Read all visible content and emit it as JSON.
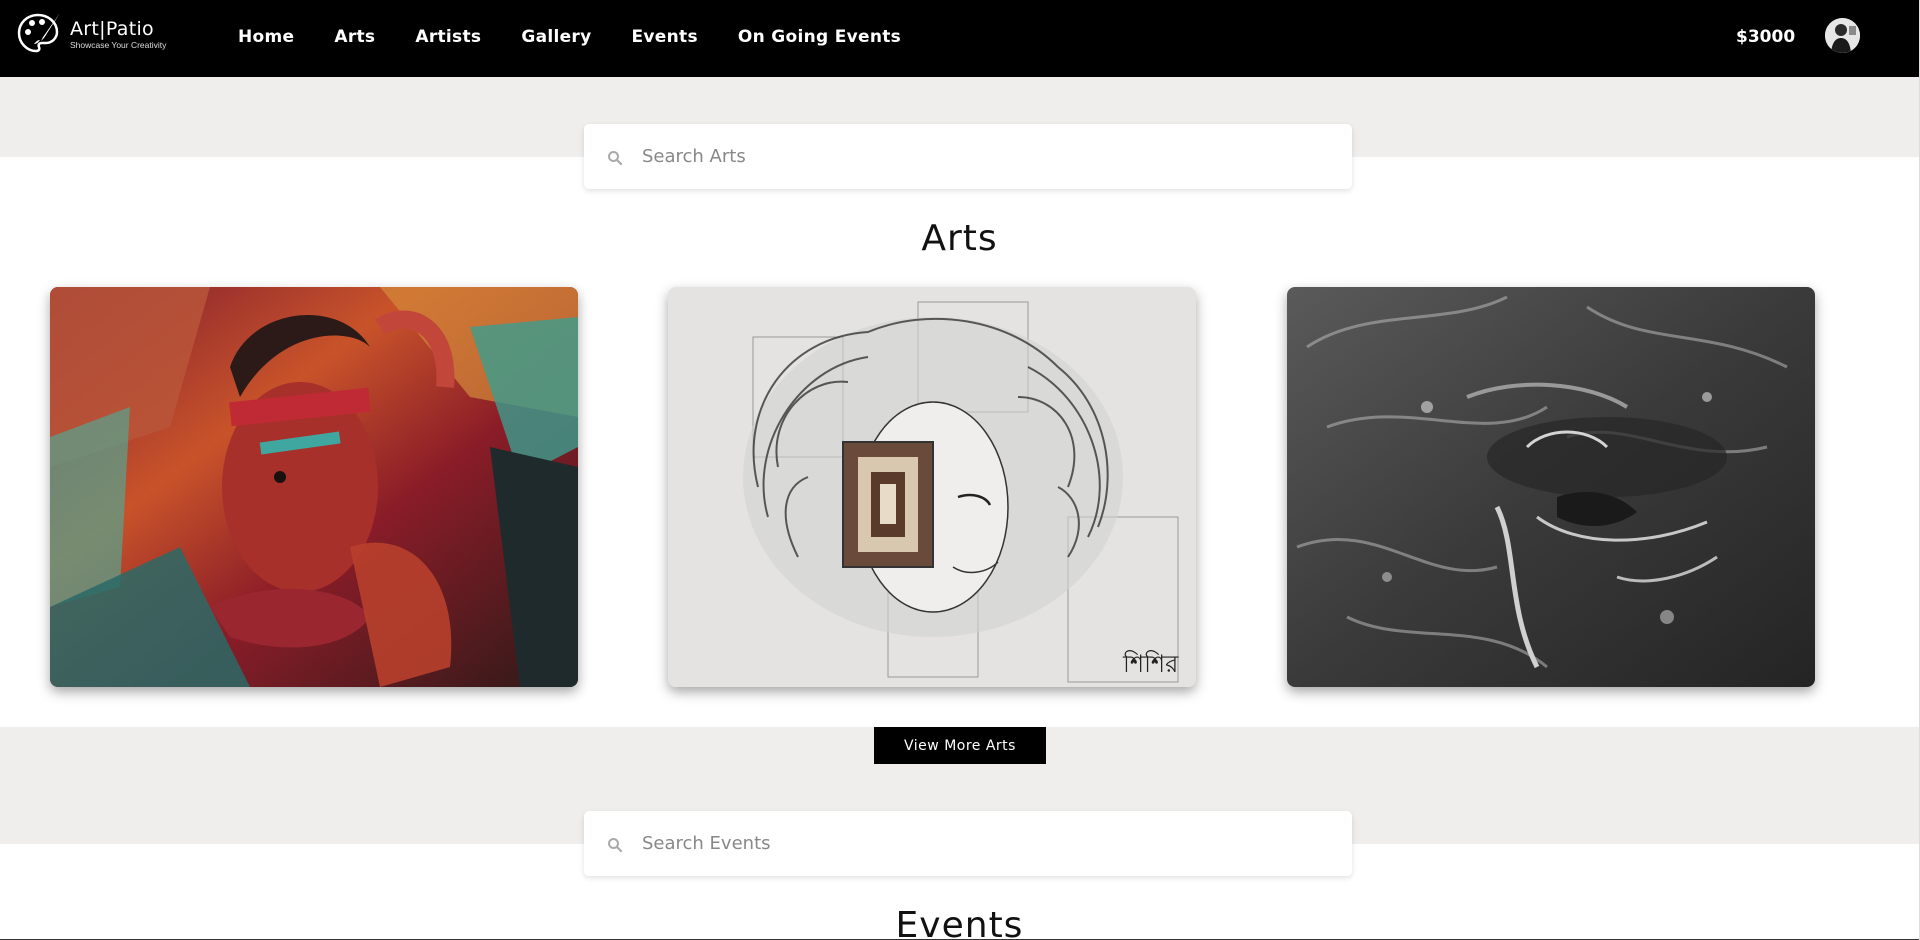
{
  "brand": {
    "title": "Art|Patio",
    "tagline": "Showcase Your Creativity"
  },
  "nav": {
    "items": [
      {
        "label": "Home"
      },
      {
        "label": "Arts"
      },
      {
        "label": "Artists"
      },
      {
        "label": "Gallery"
      },
      {
        "label": "Events"
      },
      {
        "label": "On Going Events"
      }
    ],
    "balance": "$3000"
  },
  "arts_section": {
    "search_placeholder": "Search Arts",
    "title": "Arts",
    "cards": [
      {
        "name": "Colorful painted face portrait"
      },
      {
        "name": "Pencil sketch of curly-haired man"
      },
      {
        "name": "Charcoal drawing of face under water"
      }
    ],
    "view_more_label": "View More Arts"
  },
  "events_section": {
    "search_placeholder": "Search Events",
    "title": "Events"
  },
  "colors": {
    "navbar": "#000000",
    "band": "#efeeec",
    "button": "#000000"
  }
}
